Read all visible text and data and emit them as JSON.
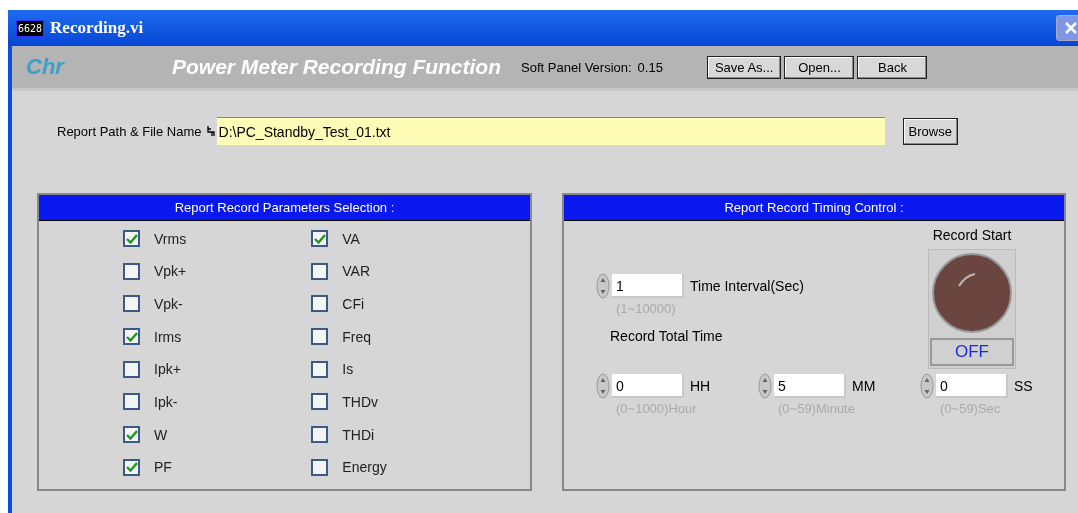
{
  "window": {
    "icon_text": "6628",
    "title": "Recording.vi"
  },
  "header": {
    "logo": "Chr",
    "title": "Power Meter Recording Function",
    "version_label": "Soft Panel Version:",
    "version": "0.15",
    "buttons": [
      "Save As...",
      "Open...",
      "Back"
    ]
  },
  "report_path": {
    "label": "Report Path & File Name",
    "value": "D:\\PC_Standby_Test_01.txt",
    "browse": "Browse"
  },
  "parameters": {
    "title": "Report Record Parameters Selection :",
    "columns": [
      [
        {
          "label": "Vrms",
          "checked": true
        },
        {
          "label": "Vpk+",
          "checked": false
        },
        {
          "label": "Vpk-",
          "checked": false
        },
        {
          "label": "Irms",
          "checked": true
        },
        {
          "label": "Ipk+",
          "checked": false
        },
        {
          "label": "Ipk-",
          "checked": false
        },
        {
          "label": "W",
          "checked": true
        },
        {
          "label": "PF",
          "checked": true
        }
      ],
      [
        {
          "label": "VA",
          "checked": true
        },
        {
          "label": "VAR",
          "checked": false
        },
        {
          "label": "CFi",
          "checked": false
        },
        {
          "label": "Freq",
          "checked": false
        },
        {
          "label": "Is",
          "checked": false
        },
        {
          "label": "THDv",
          "checked": false
        },
        {
          "label": "THDi",
          "checked": false
        },
        {
          "label": "Energy",
          "checked": false
        }
      ]
    ]
  },
  "timing": {
    "title": "Report Record Timing Control :",
    "interval": {
      "value": "1",
      "label": "Time Interval(Sec)",
      "range": "(1~10000)"
    },
    "total_label": "Record Total Time",
    "total_fields": [
      {
        "value": "0",
        "unit": "HH",
        "range": "(0~1000)Hour"
      },
      {
        "value": "5",
        "unit": "MM",
        "range": "(0~59)Minute"
      },
      {
        "value": "0",
        "unit": "SS",
        "range": "(0~59)Sec"
      }
    ],
    "record_start": {
      "label": "Record Start",
      "state_text": "OFF",
      "on": false
    }
  }
}
